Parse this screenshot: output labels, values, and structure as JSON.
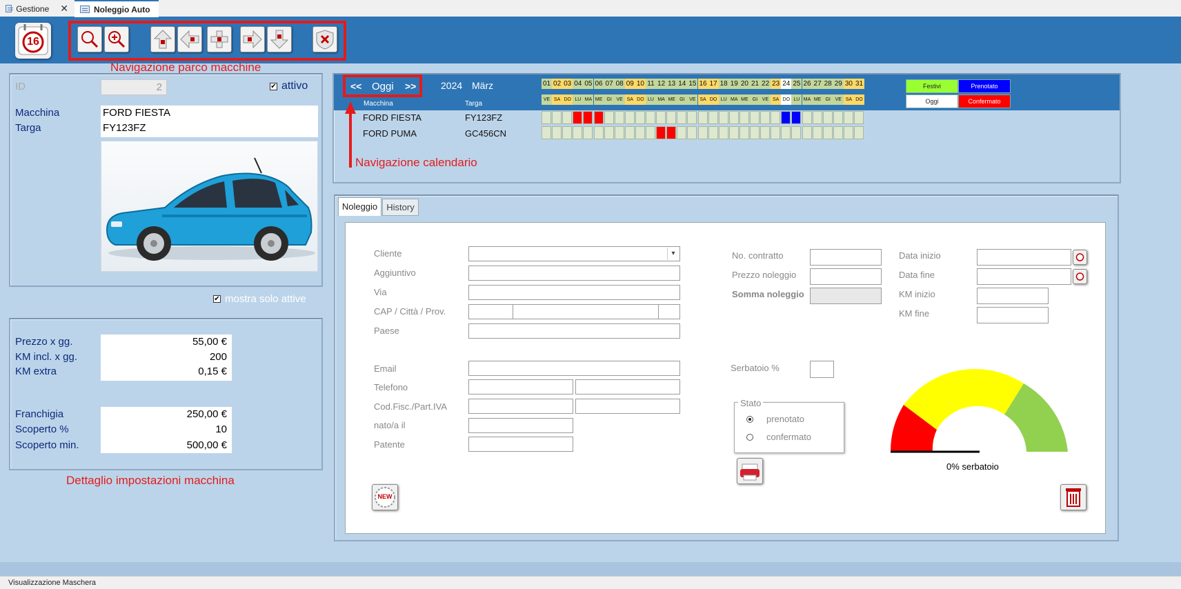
{
  "tabs": {
    "gestione": "Gestione",
    "noleggio": "Noleggio Auto"
  },
  "toolbar": {
    "calendar_day": "16"
  },
  "annotations": {
    "parco": "Navigazione parco macchine",
    "calendario": "Navigazione calendario",
    "dettaglio": "Dettaglio impostazioni macchina"
  },
  "car": {
    "id_label": "ID",
    "id_value": "2",
    "attivo_label": "attivo",
    "macchina_label": "Macchina",
    "targa_label": "Targa",
    "macchina_value": "FORD FIESTA",
    "targa_value": "FY123FZ"
  },
  "filter": {
    "mostra_solo_attive": "mostra solo attive"
  },
  "pricing": {
    "prezzo_label": "Prezzo x gg.",
    "prezzo_value": "55,00 €",
    "km_incl_label": "KM incl. x gg.",
    "km_incl_value": "200",
    "km_extra_label": "KM extra",
    "km_extra_value": "0,15 €",
    "franchigia_label": "Franchigia",
    "franchigia_value": "250,00 €",
    "scoperto_pct_label": "Scoperto %",
    "scoperto_pct_value": "10",
    "scoperto_min_label": "Scoperto min.",
    "scoperto_min_value": "500,00 €"
  },
  "calendar": {
    "prev": "<<",
    "today": "Oggi",
    "next": ">>",
    "year": "2024",
    "month": "März",
    "col_macchina": "Macchina",
    "col_targa": "Targa",
    "days": [
      "01",
      "02",
      "03",
      "04",
      "05",
      "06",
      "07",
      "08",
      "09",
      "10",
      "11",
      "12",
      "13",
      "14",
      "15",
      "16",
      "17",
      "18",
      "19",
      "20",
      "21",
      "22",
      "23",
      "24",
      "25",
      "26",
      "27",
      "28",
      "29",
      "30",
      "31"
    ],
    "weekdays": [
      "VE",
      "SA",
      "DO",
      "LU",
      "MA",
      "ME",
      "GI",
      "VE",
      "SA",
      "DO",
      "LU",
      "MA",
      "ME",
      "GI",
      "VE",
      "SA",
      "DO",
      "LU",
      "MA",
      "ME",
      "GI",
      "VE",
      "SA",
      "DO",
      "LU",
      "MA",
      "ME",
      "GI",
      "VE",
      "SA",
      "DO"
    ],
    "today_index": 23,
    "rows": [
      {
        "macchina": "FORD FIESTA",
        "targa": "FY123FZ",
        "confermato": [
          3,
          4,
          5
        ],
        "prenotato": [
          23,
          24
        ]
      },
      {
        "macchina": "FORD PUMA",
        "targa": "GC456CN",
        "confermato": [
          11,
          12
        ],
        "prenotato": []
      }
    ],
    "legend": {
      "festivi": "Festivi",
      "prenotato": "Prenotato",
      "oggi": "Oggi",
      "confermato": "Confermato"
    },
    "colors": {
      "festivo": "#ffd966",
      "feriale": "#c4d79b",
      "oggi": "#ffffff",
      "prenotato": "#0000ff",
      "confermato": "#ff0000",
      "festivi_legend": "#99ff33"
    }
  },
  "form_tabs": {
    "noleggio": "Noleggio",
    "history": "History"
  },
  "form": {
    "cliente": "Cliente",
    "aggiuntivo": "Aggiuntivo",
    "via": "Via",
    "cap": "CAP / Città / Prov.",
    "paese": "Paese",
    "email": "Email",
    "telefono": "Telefono",
    "codfisc": "Cod.Fisc./Part.IVA",
    "nato": "nato/a il",
    "patente": "Patente",
    "no_contratto": "No. contratto",
    "prezzo_noleggio": "Prezzo noleggio",
    "somma_noleggio": "Somma noleggio",
    "data_inizio": "Data inizio",
    "data_fine": "Data fine",
    "km_inizio": "KM inizio",
    "km_fine": "KM fine",
    "serbatoio": "Serbatoio %",
    "stato": "Stato",
    "prenotato": "prenotato",
    "confermato": "confermato",
    "new_badge": "NEW"
  },
  "gauge": {
    "label": "0% serbatoio",
    "value_pct": 0
  },
  "status_bar": {
    "text": "Visualizzazione Maschera"
  }
}
